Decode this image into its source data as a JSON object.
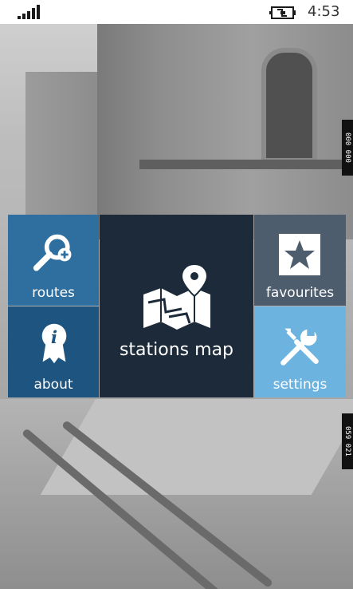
{
  "status_bar": {
    "time": "4:53",
    "signal_icon": "signal-bars-icon",
    "battery_icon": "battery-charging-icon"
  },
  "side_markers": {
    "top": "000 000",
    "bottom": "059 021"
  },
  "tiles": {
    "routes": {
      "label": "routes",
      "icon": "search-plus-icon",
      "color": "#2f6f9f"
    },
    "stations_map": {
      "label": "stations map",
      "icon": "map-pin-icon",
      "color": "#1c2a3a"
    },
    "favourites": {
      "label": "favourites",
      "icon": "star-icon",
      "color": "#4d5d6d"
    },
    "about": {
      "label": "about",
      "icon": "info-badge-icon",
      "color": "#1e5480"
    },
    "settings": {
      "label": "settings",
      "icon": "tools-icon",
      "color": "#6cb3e0"
    }
  }
}
